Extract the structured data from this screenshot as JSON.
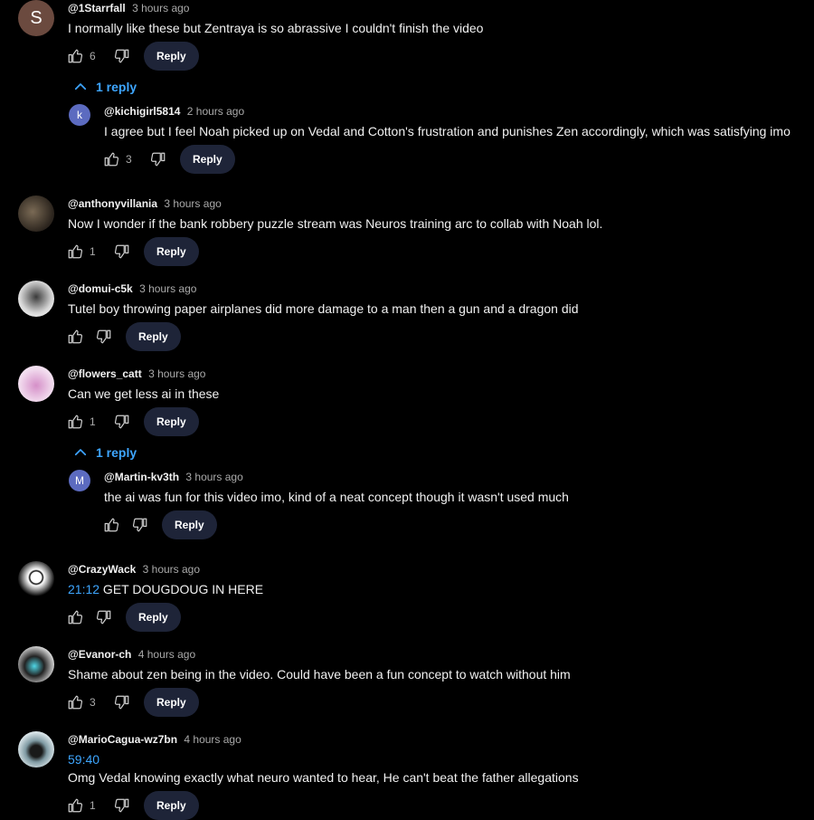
{
  "reply_label": "Reply",
  "accent": "#3ea6ff",
  "comments": [
    {
      "author": "@1Starrfall",
      "time": "3 hours ago",
      "text": "I normally like these but Zentraya is so abrassive I couldn't finish the video",
      "likes": "6",
      "avatar_letter": "S",
      "avatar_color": "#6b4a3f",
      "toggle_label": "1 reply",
      "reply": {
        "author": "@kichigirl5814",
        "time": "2 hours ago",
        "text": "I agree but I feel Noah picked up on Vedal and Cotton's frustration and punishes Zen accordingly, which was satisfying imo",
        "likes": "3",
        "avatar_letter": "k",
        "avatar_color": "#5c6bc0"
      }
    },
    {
      "author": "@anthonyvillania",
      "time": "3 hours ago",
      "text": "Now I wonder if the bank robbery puzzle stream was Neuros training arc to collab with Noah lol.",
      "likes": "1"
    },
    {
      "author": "@domui-c5k",
      "time": "3 hours ago",
      "text": "Tutel boy throwing paper airplanes did more damage to a man then a gun and a dragon did",
      "likes": ""
    },
    {
      "author": "@flowers_catt",
      "time": "3 hours ago",
      "text": "Can we get less ai in these",
      "likes": "1",
      "toggle_label": "1 reply",
      "reply": {
        "author": "@Martin-kv3th",
        "time": "3 hours ago",
        "text": "the ai was fun for this video imo, kind of a neat concept though it wasn't used much",
        "likes": "",
        "avatar_letter": "M",
        "avatar_color": "#5c6bc0"
      }
    },
    {
      "author": "@CrazyWack",
      "time": "3 hours ago",
      "timestamp": "21:12",
      "text": " GET DOUGDOUG IN HERE",
      "likes": ""
    },
    {
      "author": "@Evanor-ch",
      "time": "4 hours ago",
      "text": "Shame about zen being in the video. Could have been a fun concept to watch without him",
      "likes": "3"
    },
    {
      "author": "@MarioCagua-wz7bn",
      "time": "4 hours ago",
      "timestamp": "59:40",
      "text": "Omg Vedal knowing exactly what neuro wanted to hear, He can't beat the father allegations",
      "likes": "1"
    }
  ]
}
